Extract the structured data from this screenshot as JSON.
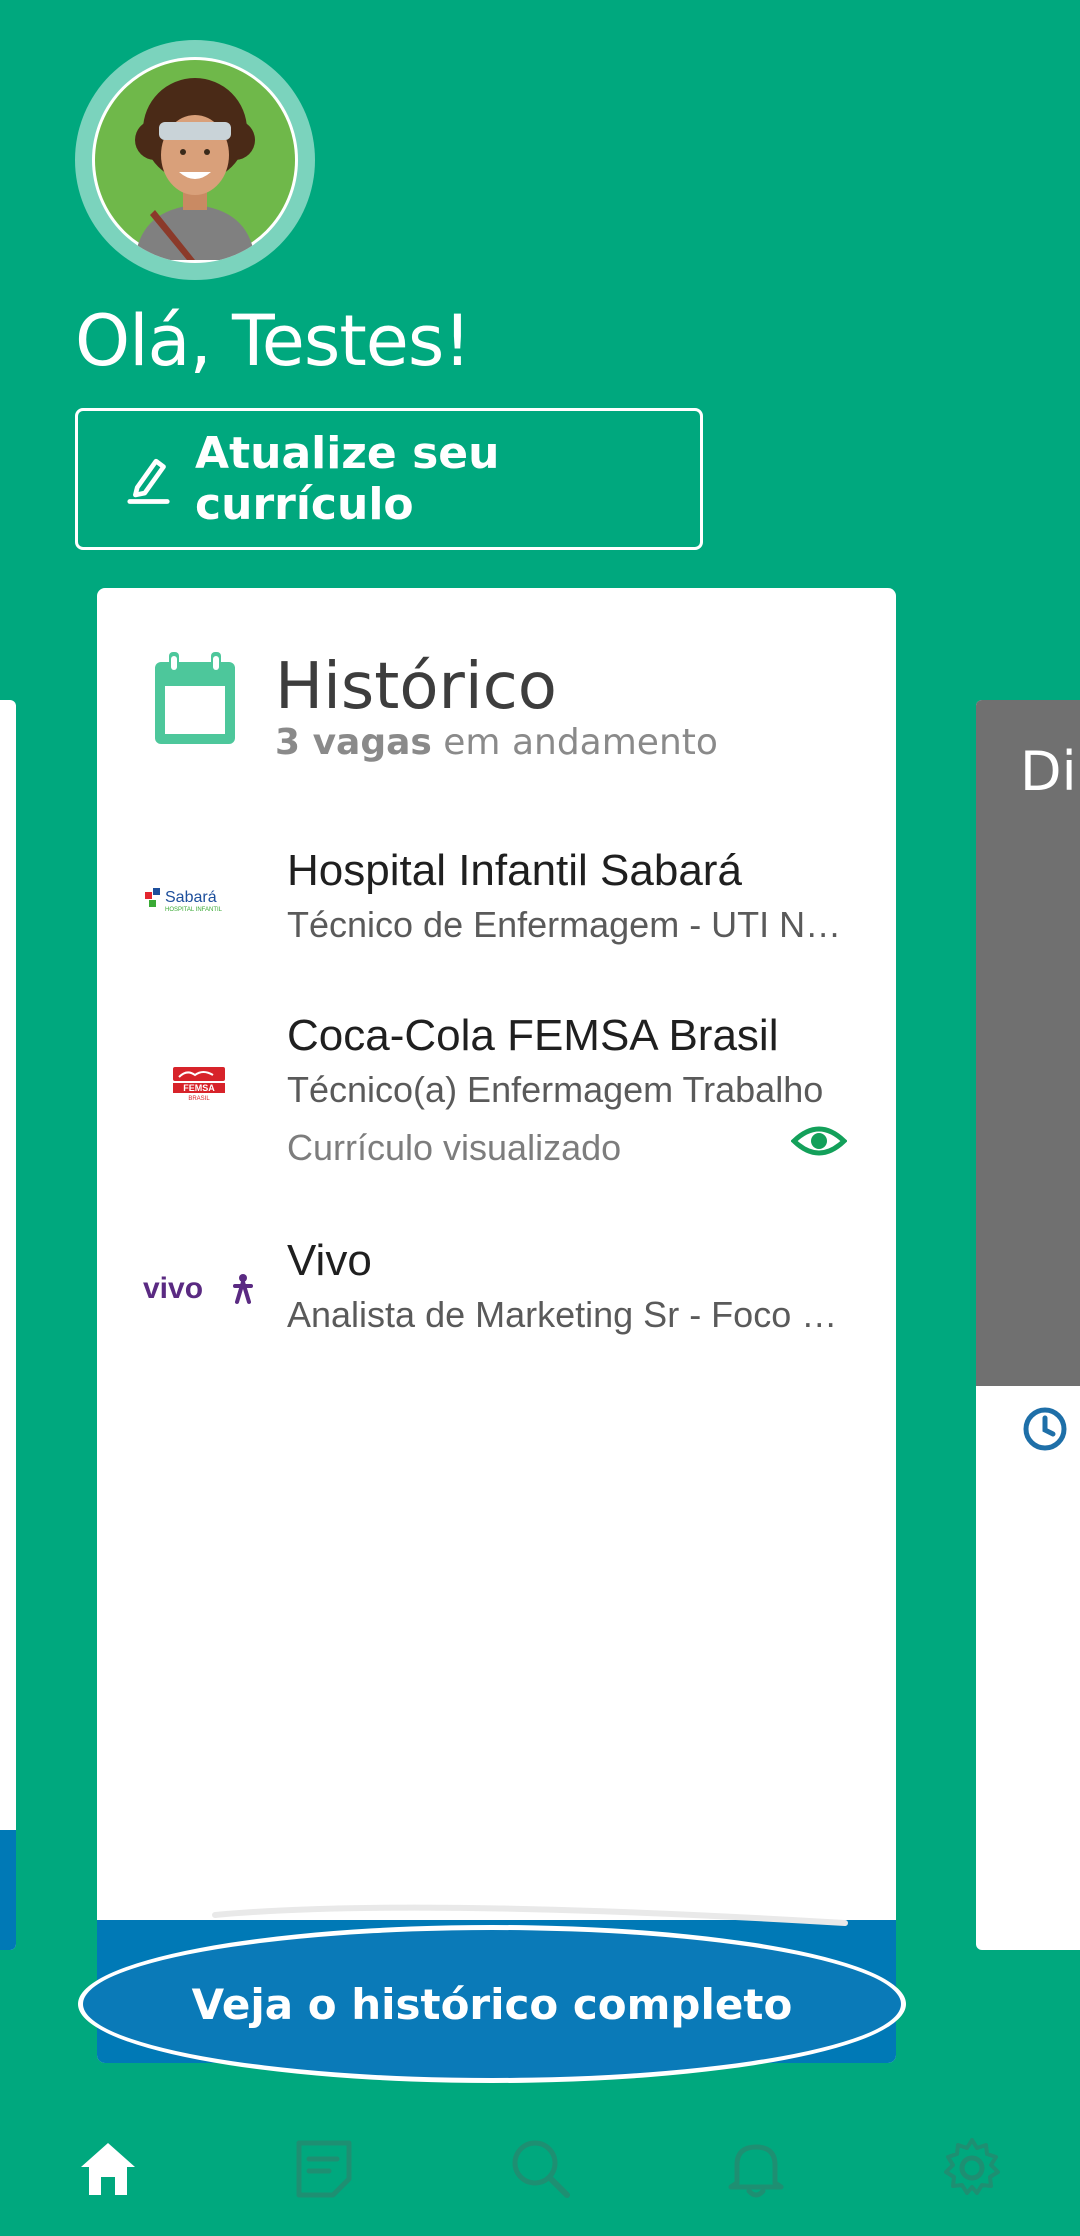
{
  "profile": {
    "greeting": "Olá, Testes!"
  },
  "update_button": {
    "label": "Atualize seu currículo"
  },
  "history_card": {
    "title": "Histórico",
    "subtitle_count": "3 vagas",
    "subtitle_rest": " em andamento",
    "jobs": [
      {
        "company": "Hospital Infantil Sabará",
        "role": "Técnico de Enfermagem - UTI Neonatal",
        "status": "",
        "logo": "sabara-logo",
        "logo_text": "Sabará",
        "logo_subtext": "HOSPITAL INFANTIL"
      },
      {
        "company": "Coca-Cola FEMSA Brasil",
        "role": "Técnico(a) Enfermagem Trabalho",
        "status": "Currículo visualizado",
        "logo": "coca-cola-femsa-logo",
        "logo_text": "FEMSA",
        "logo_subtext": "BRASIL"
      },
      {
        "company": "Vivo",
        "role": "Analista de Marketing Sr - Foco em Performance",
        "status": "",
        "logo": "vivo-logo",
        "logo_text": "vivo"
      }
    ],
    "full_history_button": "Veja o histórico completo"
  },
  "right_card": {
    "title_fragment": "Di"
  },
  "nav": [
    {
      "name": "home-icon",
      "active": true
    },
    {
      "name": "curriculum-icon",
      "active": false
    },
    {
      "name": "search-icon",
      "active": false
    },
    {
      "name": "notifications-icon",
      "active": false
    },
    {
      "name": "settings-icon",
      "active": false
    }
  ],
  "colors": {
    "background": "#00a87e",
    "accent_blue": "#0079b6",
    "calendar_green": "#4dc79b",
    "nav_inactive": "#1e8f72"
  }
}
